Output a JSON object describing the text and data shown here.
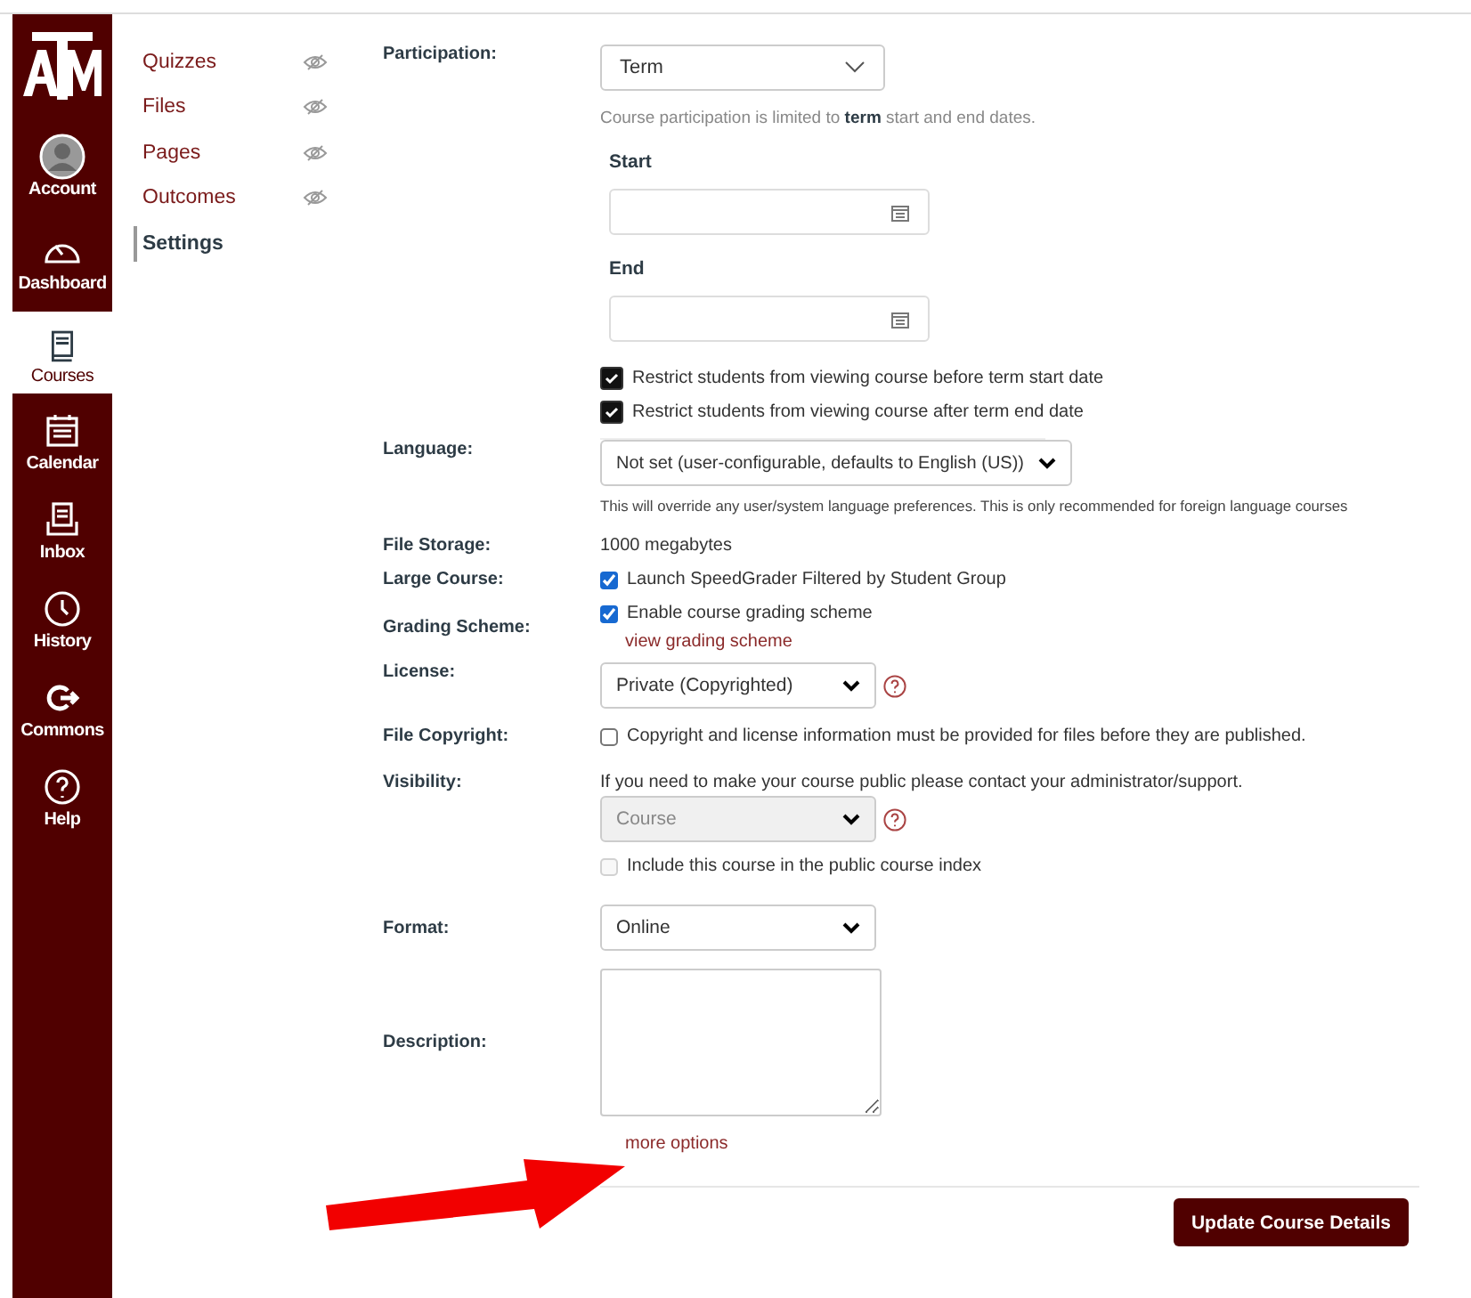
{
  "global_nav": {
    "items": [
      {
        "label": "Account",
        "kind": "account",
        "selected": false
      },
      {
        "label": "Dashboard",
        "kind": "dashboard",
        "selected": false
      },
      {
        "label": "Courses",
        "kind": "courses",
        "selected": true
      },
      {
        "label": "Calendar",
        "kind": "calendar",
        "selected": false
      },
      {
        "label": "Inbox",
        "kind": "inbox",
        "selected": false
      },
      {
        "label": "History",
        "kind": "history",
        "selected": false
      },
      {
        "label": "Commons",
        "kind": "commons",
        "selected": false
      },
      {
        "label": "Help",
        "kind": "help",
        "selected": false
      }
    ]
  },
  "course_nav": {
    "items": [
      {
        "label": "Quizzes",
        "hidden": true,
        "selected": false
      },
      {
        "label": "Files",
        "hidden": true,
        "selected": false
      },
      {
        "label": "Pages",
        "hidden": true,
        "selected": false
      },
      {
        "label": "Outcomes",
        "hidden": true,
        "selected": false
      },
      {
        "label": "Settings",
        "hidden": false,
        "selected": true
      }
    ]
  },
  "form": {
    "participation": {
      "label": "Participation:",
      "value": "Term",
      "hint": "Course participation is limited to **term** start and end dates.",
      "start_label": "Start",
      "end_label": "End",
      "restrictions": [
        {
          "label": "Restrict students from viewing course before term start date",
          "checked": true
        },
        {
          "label": "Restrict students from viewing course after term end date",
          "checked": true
        }
      ]
    },
    "language": {
      "label": "Language:",
      "value": "Not set (user-configurable, defaults to English (US))",
      "hint": "This will override any user/system language preferences. This is only recommended for foreign language courses"
    },
    "file_storage": {
      "label": "File Storage:",
      "value": "1000 megabytes"
    },
    "large_course": {
      "label": "Large Course:",
      "option": {
        "label": "Launch SpeedGrader Filtered by Student Group",
        "checked": true
      }
    },
    "grading_scheme": {
      "label": "Grading Scheme:",
      "option": {
        "label": "Enable course grading scheme",
        "checked": true
      },
      "link": "view grading scheme"
    },
    "license": {
      "label": "License:",
      "value": "Private (Copyrighted)"
    },
    "file_copyright": {
      "label": "File Copyright:",
      "option": {
        "label": "Copyright and license information must be provided for files before they are published.",
        "checked": false
      }
    },
    "visibility": {
      "label": "Visibility:",
      "note": "If you need to make your course public please contact your administrator/support.",
      "value": "Course",
      "disabled": true,
      "option": {
        "label": "Include this course in the public course index",
        "checked": false,
        "disabled": true
      }
    },
    "format": {
      "label": "Format:",
      "value": "Online"
    },
    "description": {
      "label": "Description:"
    },
    "more_options": "more options",
    "submit": "Update Course Details"
  }
}
